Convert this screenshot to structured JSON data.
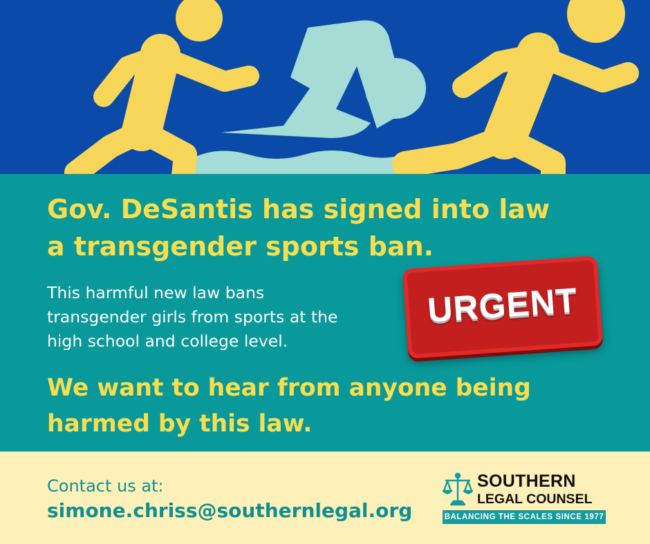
{
  "header": {
    "icons": [
      "runner-left-icon",
      "swimmer-icon",
      "runner-right-icon"
    ]
  },
  "main": {
    "headline_line1": "Gov. DeSantis has signed into law",
    "headline_line2": "a transgender sports ban.",
    "body_line1": "This harmful new law bans",
    "body_line2": "transgender girls from sports at the",
    "body_line3": "high school and college level.",
    "stamp_text": "URGENT",
    "callout_line1": "We want to hear from anyone being",
    "callout_line2": "harmed by this law."
  },
  "footer": {
    "contact_label": "Contact us at:",
    "contact_email": "simone.chriss@southernlegal.org",
    "logo": {
      "line1": "SOUTHERN",
      "line2": "LEGAL COUNSEL",
      "tagline": "BALANCING THE SCALES SINCE 1977",
      "icon": "scales-icon"
    }
  },
  "colors": {
    "banner_blue": "#0a4aa8",
    "runner_yellow": "#f8d659",
    "swimmer_mint": "#a6dcd6",
    "teal": "#09999a",
    "headline_yellow": "#f8de4e",
    "cream": "#fdf0b8",
    "urgent_red": "#c41f1f"
  }
}
